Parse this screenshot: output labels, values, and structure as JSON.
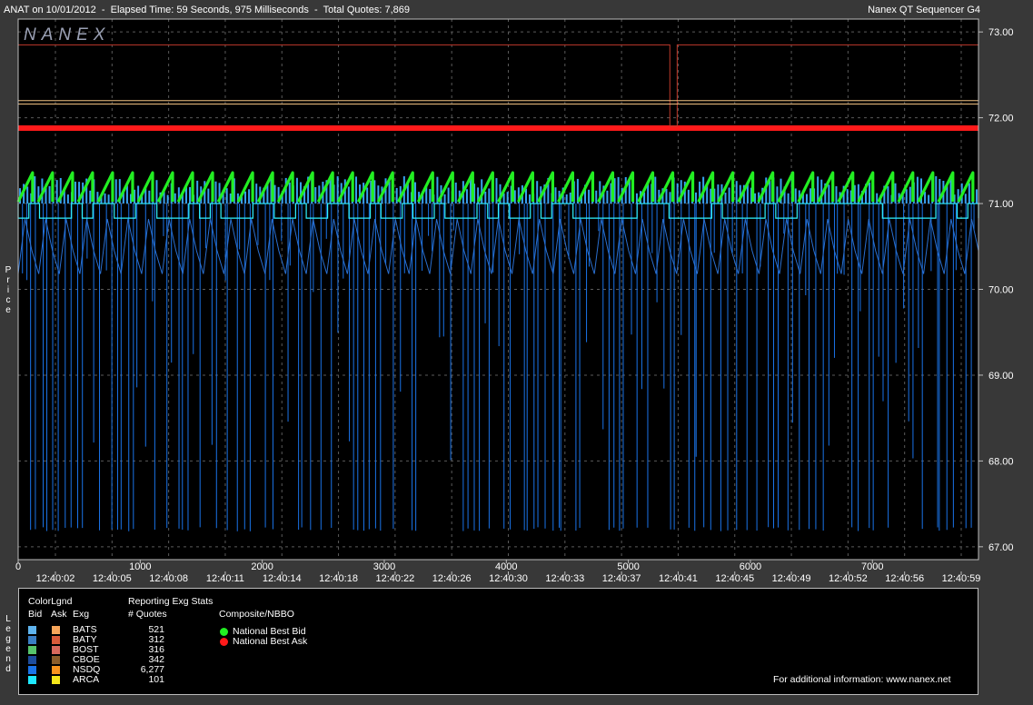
{
  "header": {
    "left": "ANAT on 10/01/2012  -  Elapsed Time: 59 Seconds, 975 Milliseconds  -  Total Quotes: 7,869",
    "right": "Nanex QT Sequencer G4"
  },
  "logo_text": "NANEX",
  "side_labels": {
    "price": "Price",
    "legend": "Legend"
  },
  "colors": {
    "background": "#000000",
    "frame": "#383838",
    "nbb": "#22ee22",
    "nbo": "#ff1a1a",
    "bats_bid": "#39a9f5",
    "nsdq_bid": "#1a73e8",
    "arca_bid": "#2ff2ff",
    "top_ask": "#c0392b",
    "mid_ask": "#f0c080"
  },
  "chart_data": {
    "type": "line",
    "title": "",
    "xlabel": "",
    "ylabel": "Price",
    "xlim": [
      0,
      7869
    ],
    "ylim": [
      66.85,
      73.15
    ],
    "x_ticks": [
      0,
      1000,
      2000,
      3000,
      4000,
      5000,
      6000,
      7000
    ],
    "y_ticks": [
      67.0,
      68.0,
      69.0,
      70.0,
      71.0,
      72.0,
      73.0
    ],
    "y_tick_labels": [
      "67.00",
      "68.00",
      "69.00",
      "70.00",
      "71.00",
      "72.00",
      "73.00"
    ],
    "time_labels": [
      "12:40:02",
      "12:40:05",
      "12:40:08",
      "12:40:11",
      "12:40:14",
      "12:40:18",
      "12:40:22",
      "12:40:26",
      "12:40:30",
      "12:40:33",
      "12:40:37",
      "12:40:41",
      "12:40:45",
      "12:40:49",
      "12:40:52",
      "12:40:56",
      "12:40:59"
    ],
    "grid": true,
    "series": [
      {
        "name": "National Best Ask",
        "color": "#ff1a1a",
        "x": [
          0,
          7869
        ],
        "y": [
          71.88,
          71.88
        ]
      },
      {
        "name": "National Best Bid",
        "color": "#22ee22",
        "sawtooth": {
          "low": 71.02,
          "high": 71.36,
          "cycles": 48
        }
      },
      {
        "color": "#c0392b",
        "x": [
          0,
          5340,
          5340,
          5400,
          5400,
          7869
        ],
        "y": [
          72.85,
          72.85,
          71.9,
          71.9,
          72.85,
          72.85
        ]
      },
      {
        "color": "#f0c080",
        "x": [
          0,
          7869
        ],
        "y": [
          72.2,
          72.2
        ]
      },
      {
        "color": "#f0c080",
        "x": [
          0,
          7869
        ],
        "y": [
          72.16,
          72.16
        ]
      },
      {
        "color": "#2ff2ff",
        "band": {
          "low": 70.83,
          "high": 71.0
        }
      },
      {
        "color": "#1a73e8",
        "spikes": {
          "base": 71.0,
          "min": 67.18,
          "count": 170
        }
      }
    ]
  },
  "legend": {
    "heading_color": "ColorLgnd",
    "col_bid": "Bid",
    "col_ask": "Ask",
    "col_exg": "Exg",
    "heading_stats": "Reporting Exg Stats",
    "col_quotes": "# Quotes",
    "heading_nbbo": "Composite/NBBO",
    "rows": [
      {
        "exg": "BATS",
        "quotes": "521",
        "bid_color": "#5fb4ee",
        "ask_color": "#f7a55a"
      },
      {
        "exg": "BATY",
        "quotes": "312",
        "bid_color": "#3a7ec4",
        "ask_color": "#d95a3a"
      },
      {
        "exg": "BOST",
        "quotes": "316",
        "bid_color": "#57c46a",
        "ask_color": "#d7685c"
      },
      {
        "exg": "CBOE",
        "quotes": "342",
        "bid_color": "#1d4c9c",
        "ask_color": "#8a5c2a"
      },
      {
        "exg": "NSDQ",
        "quotes": "6,277",
        "bid_color": "#1a73e8",
        "ask_color": "#f7931e"
      },
      {
        "exg": "ARCA",
        "quotes": "101",
        "bid_color": "#1ee8ff",
        "ask_color": "#f5e61a"
      }
    ],
    "nbbo": [
      {
        "label": "National Best Bid",
        "color": "#22ee22"
      },
      {
        "label": "National Best Ask",
        "color": "#ff1a1a"
      }
    ],
    "footer": "For additional information: www.nanex.net"
  }
}
